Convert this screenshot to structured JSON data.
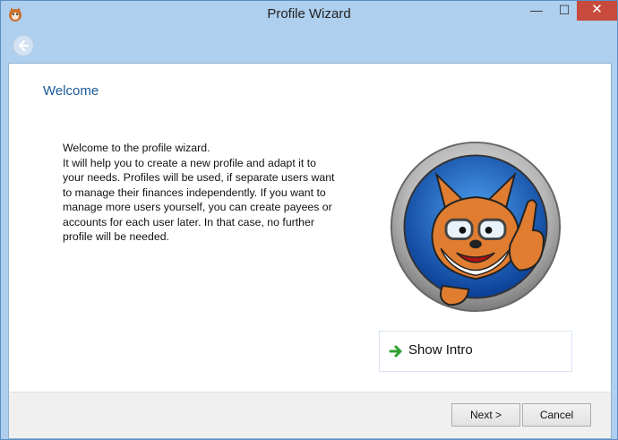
{
  "window": {
    "title": "Profile Wizard",
    "controls": {
      "minimize": "—",
      "maximize": "☐",
      "close": "✕"
    }
  },
  "page": {
    "heading": "Welcome",
    "text_lines": [
      "Welcome to the profile wizard.",
      "It will help you to create a new profile and adapt it to",
      "your needs. Profiles will be used, if separate users want",
      "to manage their finances independently. If you want to",
      "manage more users yourself, you can create payees or",
      "accounts for each user later. In that case, no further",
      "profile will be needed."
    ],
    "show_intro_label": "Show Intro"
  },
  "buttons": {
    "next": "Next >",
    "cancel": "Cancel"
  },
  "icons": [
    "fox-app-icon",
    "back-arrow-icon",
    "fox-mascot-logo",
    "green-arrow-icon"
  ]
}
